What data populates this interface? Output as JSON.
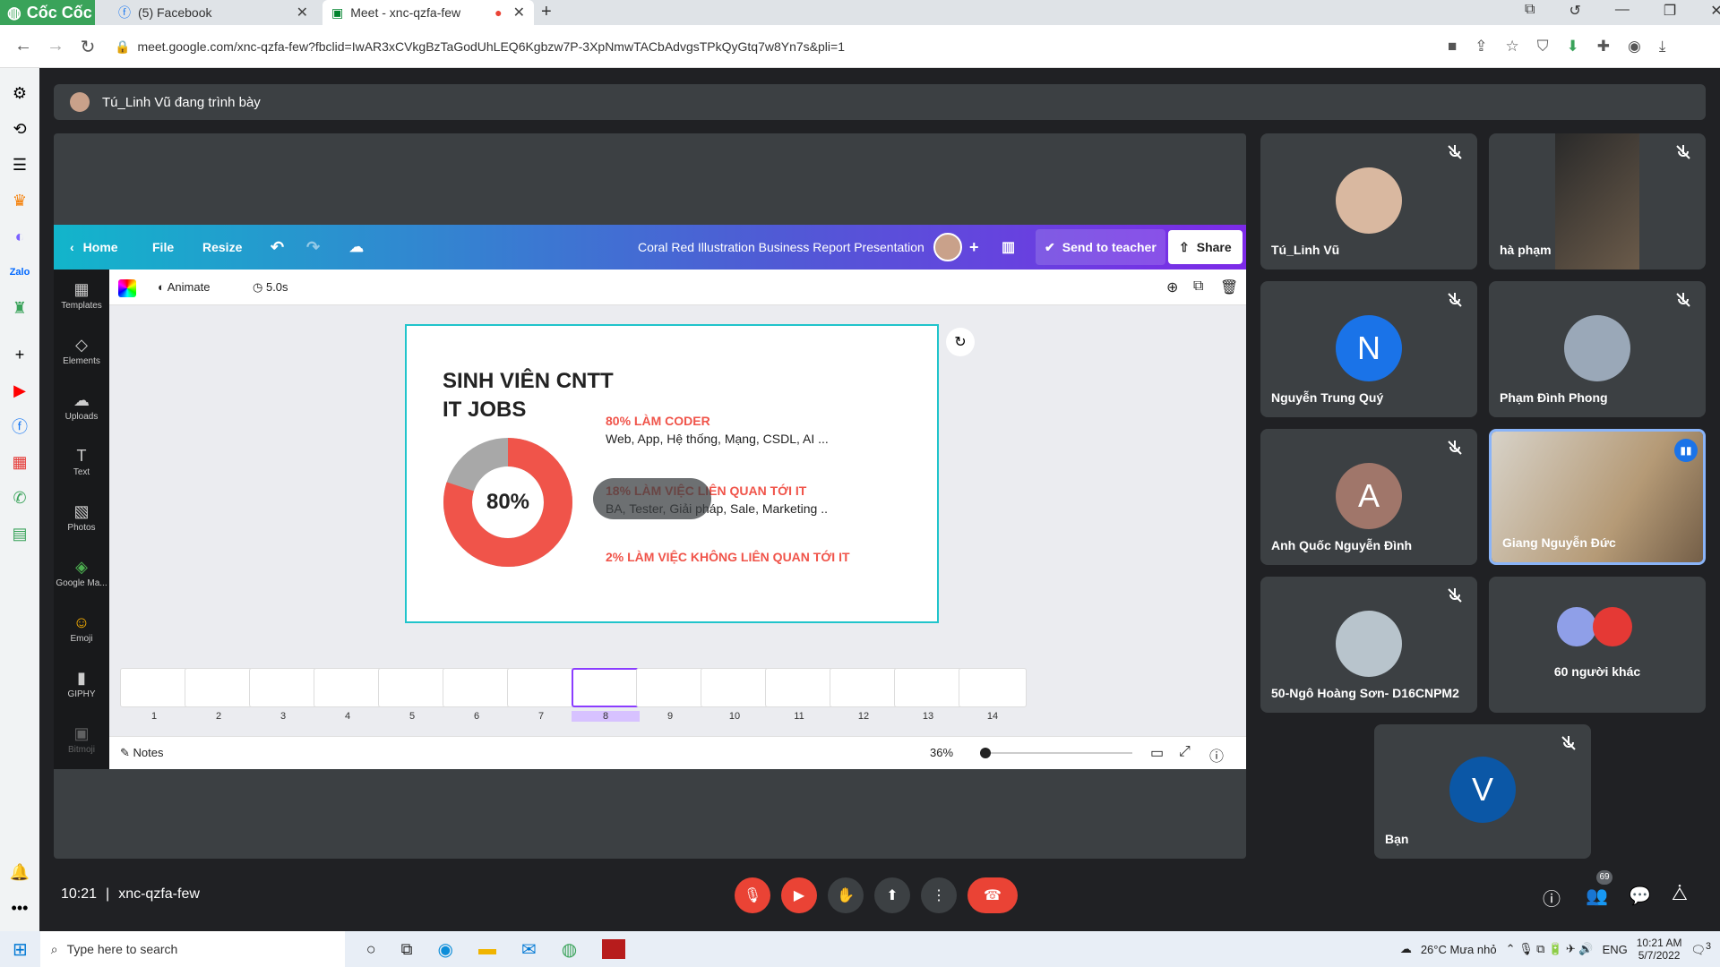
{
  "browser": {
    "brand": "Cốc Cốc",
    "tabs": [
      {
        "label": "(5) Facebook"
      },
      {
        "label": "Meet - xnc-qzfa-few"
      }
    ],
    "url": "meet.google.com/xnc-qzfa-few?fbclid=IwAR3xCVkgBzTaGodUhLEQ6Kgbzw7P-3XpNmwTACbAdvgsTPkQyGtq7w8Yn7s&pli=1"
  },
  "presenter": {
    "text": "Tú_Linh Vũ đang trình bày"
  },
  "canva": {
    "home": "Home",
    "file": "File",
    "resize": "Resize",
    "title": "Coral Red Illustration Business Report Presentation",
    "send": "Send to teacher",
    "share": "Share",
    "animate": "Animate",
    "duration": "5.0s",
    "notes": "Notes",
    "zoom": "36%",
    "rail": [
      "Templates",
      "Elements",
      "Uploads",
      "Text",
      "Photos",
      "Google Ma...",
      "Emoji",
      "GIPHY",
      "Bitmoji"
    ]
  },
  "slide": {
    "title1": "SINH VIÊN CNTT",
    "title2": "IT JOBS",
    "donut": "80%",
    "l1h": "80% LÀM CODER",
    "l1t": "Web, App, Hệ thống, Mạng, CSDL, AI ...",
    "l2h": "18% LÀM VIỆC LIÊN QUAN TỚI IT",
    "l2t": "BA, Tester, Giải pháp, Sale, Marketing ..",
    "l3h": "2% LÀM VIỆC KHÔNG LIÊN QUAN TỚI IT",
    "donut_fraction": 0.8
  },
  "thumbs": [
    "1",
    "2",
    "3",
    "4",
    "5",
    "6",
    "7",
    "8",
    "9",
    "10",
    "11",
    "12",
    "13",
    "14"
  ],
  "participants": [
    {
      "name": "Tú_Linh Vũ"
    },
    {
      "name": "hà phạm"
    },
    {
      "name": "Nguyễn Trung Quý",
      "initial": "N"
    },
    {
      "name": "Phạm Đình Phong"
    },
    {
      "name": "Anh Quốc Nguyễn Đình",
      "initial": "A"
    },
    {
      "name": "Giang Nguyễn Đức"
    },
    {
      "name": "50-Ngô Hoàng Sơn- D16CNPM2"
    },
    {
      "name": "60 người khác"
    },
    {
      "name": "Bạn",
      "initial": "V"
    }
  ],
  "meeting": {
    "time": "10:21",
    "sep": "|",
    "code": "xnc-qzfa-few",
    "people_badge": "69"
  },
  "taskbar": {
    "search": "Type here to search",
    "weather": "26°C  Mưa nhỏ",
    "lang": "ENG",
    "time": "10:21 AM",
    "date": "5/7/2022",
    "notif": "3"
  },
  "colors": {
    "accent": "#ea4335",
    "canva1": "#12b5cb",
    "canva2": "#7d2ae8",
    "slideRed": "#f0544a"
  }
}
